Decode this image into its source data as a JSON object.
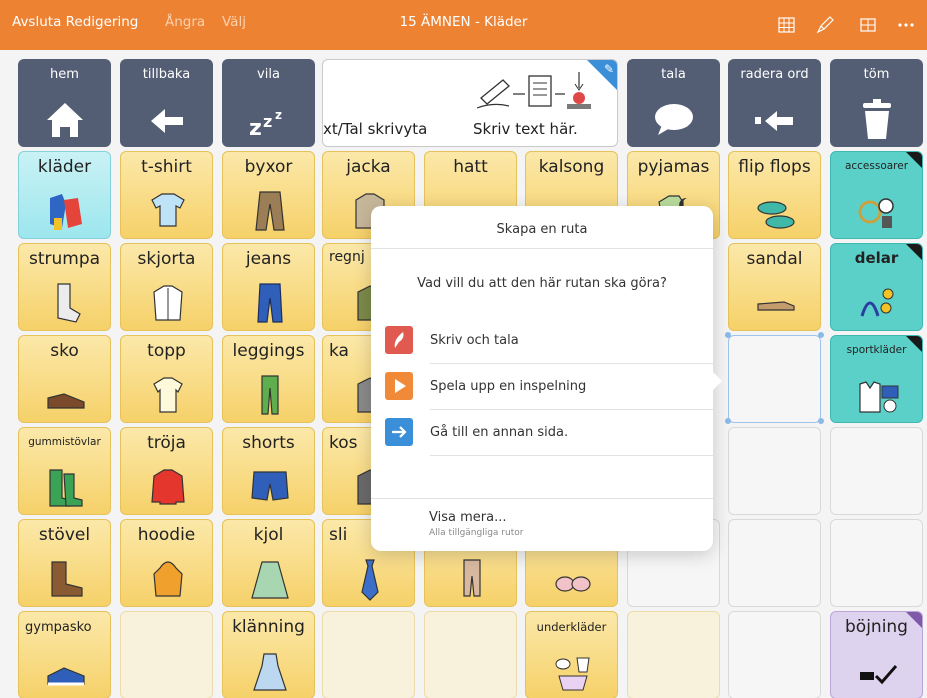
{
  "topbar": {
    "finish_edit": "Avsluta Redigering",
    "undo": "Ångra",
    "select": "Välj",
    "title": "15 ÄMNEN - Kläder",
    "icons": [
      "grid-edit-icon",
      "brush-icon",
      "grid-icon",
      "more-icon"
    ]
  },
  "nav": {
    "home": "hem",
    "back": "tillbaka",
    "rest": "vila",
    "speak": "tala",
    "delete_word": "radera ord",
    "clear": "töm"
  },
  "text_area": {
    "label_left": "xt/Tal skrivyta",
    "label_right": "Skriv text här."
  },
  "cells": {
    "r1": [
      "kläder",
      "t-shirt",
      "byxor",
      "jacka",
      "hatt",
      "kalsong",
      "pyjamas",
      "flip flops",
      "accessoarer"
    ],
    "r2": [
      "strumpa",
      "skjorta",
      "jeans",
      "regnj",
      "sandal",
      "delar"
    ],
    "r3": [
      "sko",
      "topp",
      "leggings",
      "ka",
      "sportkläder"
    ],
    "r4": [
      "gummistövlar",
      "tröja",
      "shorts",
      "kos"
    ],
    "r5": [
      "stövel",
      "hoodie",
      "kjol",
      "sli"
    ],
    "r6": [
      "gympasko",
      "klänning",
      "underkläder",
      "böjning"
    ]
  },
  "popup": {
    "title": "Skapa en ruta",
    "question": "Vad vill du att den här rutan ska göra?",
    "options": [
      {
        "label": "Skriv och tala",
        "icon": "feather-icon",
        "color": "#e05a4f"
      },
      {
        "label": "Spela upp en inspelning",
        "icon": "play-icon",
        "color": "#f08a38"
      },
      {
        "label": "Gå till en annan sida.",
        "icon": "arrow-right-icon",
        "color": "#3b8fd9"
      }
    ],
    "more": "Visa mera...",
    "more_sub": "Alla tillgängliga rutor"
  },
  "colors": {
    "topbar": "#ee8233",
    "nav_cell": "#535e74",
    "word_cell": "#f6d169",
    "category_cell": "#9de6ee",
    "folder_cell": "#5bd0c9",
    "grammar_cell": "#ded3ee"
  }
}
